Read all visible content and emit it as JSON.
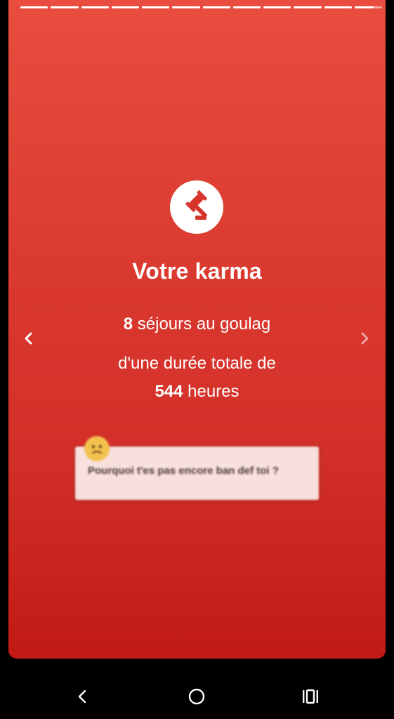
{
  "story": {
    "progress": {
      "segments_total": 12,
      "segments_complete": 11,
      "current_segment_fraction": 0.7
    },
    "icon": "gavel-icon",
    "title": "Votre karma",
    "stats": {
      "stays_count": "8",
      "stays_label": "séjours au goulag",
      "duration_intro": "d'une durée totale de",
      "hours_count": "544",
      "hours_label": "heures"
    },
    "comment": {
      "avatar_icon": "emoji-face-icon",
      "text": "Pourquoi t'es pas encore ban def toi ?"
    },
    "nav": {
      "prev_icon": "chevron-left-icon",
      "next_icon": "chevron-right-icon"
    }
  },
  "system_nav": {
    "back_icon": "back-icon",
    "home_icon": "home-icon",
    "recents_icon": "recents-icon"
  },
  "colors": {
    "card_top": "#e84d3f",
    "card_bottom": "#c11a16",
    "icon_red": "#d7352c",
    "comment_bg": "#f8e0dc"
  }
}
